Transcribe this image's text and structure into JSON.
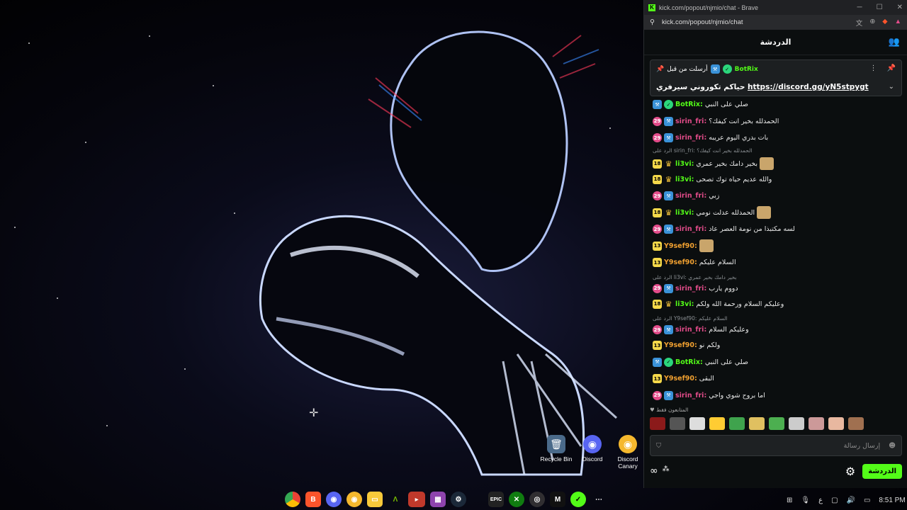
{
  "desktop": {
    "icons": [
      {
        "label": "Recycle Bin",
        "icon": "recycle-bin-icon"
      },
      {
        "label": "Discord",
        "icon": "discord-icon"
      },
      {
        "label": "Discord\nCanary",
        "icon": "discord-canary-icon"
      }
    ]
  },
  "taskbar": {
    "apps": [
      "chrome-icon",
      "brave-icon",
      "discord-icon",
      "discord-canary-icon",
      "file-explorer-icon",
      "nvidia-icon",
      "capcut-icon",
      "winrar-icon",
      "steam-icon",
      "epic-games-icon",
      "xbox-icon",
      "obs-icon",
      "kick-app-icon",
      "green-app-icon",
      "more-icon"
    ],
    "epic_label": "EPIC",
    "tray": {
      "lang": "ع",
      "time": "8:51 PM"
    }
  },
  "browser": {
    "title": "kick.com/popout/njmio/chat - Brave",
    "url": "kick.com/popout/njmio/chat"
  },
  "chat": {
    "header": "الدردشة",
    "pinned": {
      "pinned_by": "أرسلت من قبل",
      "user": "BotRix",
      "text_prefix": "حياكم تكوروني سيرفري",
      "link": "https://discord.gg/yN5stpygt"
    },
    "messages": [
      {
        "badges": [
          "blue",
          "verified"
        ],
        "user": "BotRix:",
        "color": "#53fc18",
        "text": "صلي على النبي"
      },
      {
        "badges": [
          "pink",
          "blue"
        ],
        "badge_text": [
          "29",
          ""
        ],
        "user": "sirin_fri:",
        "color": "#e34c8a",
        "text": "الحمدلله بخير انت كيفك؟"
      },
      {
        "badges": [
          "pink",
          "blue"
        ],
        "badge_text": [
          "29",
          ""
        ],
        "user": "sirin_fri:",
        "color": "#e34c8a",
        "text": "بات بدري اليوم عريبه"
      },
      {
        "reply": "الرد على  sirin_fri: الحمدلله بخير انت كيفك؟",
        "badges": [
          "yel",
          "crown"
        ],
        "badge_text": [
          "18",
          ""
        ],
        "user": "li3vi:",
        "color": "#53fc18",
        "text": "بخير دامك بخير عمري",
        "emote": true
      },
      {
        "badges": [
          "yel",
          "crown"
        ],
        "badge_text": [
          "18",
          ""
        ],
        "user": "li3vi:",
        "color": "#53fc18",
        "text": "والله عديم حياه توك تصحى"
      },
      {
        "badges": [
          "pink",
          "blue"
        ],
        "badge_text": [
          "29",
          ""
        ],
        "user": "sirin_fri:",
        "color": "#e34c8a",
        "text": "زبي"
      },
      {
        "badges": [
          "yel",
          "crown"
        ],
        "badge_text": [
          "18",
          ""
        ],
        "user": "li3vi:",
        "color": "#53fc18",
        "text": "الحمدلله عدلت نومي",
        "emote": true
      },
      {
        "badges": [
          "pink",
          "blue"
        ],
        "badge_text": [
          "29",
          ""
        ],
        "user": "sirin_fri:",
        "color": "#e34c8a",
        "text": "لسه مكتبذا من نومة العصر عاد"
      },
      {
        "badges": [
          "yel"
        ],
        "badge_text": [
          "13"
        ],
        "user": "Y9sef90:",
        "color": "#f0a030",
        "text": "",
        "emote": true
      },
      {
        "badges": [
          "yel"
        ],
        "badge_text": [
          "13"
        ],
        "user": "Y9sef90:",
        "color": "#f0a030",
        "text": "السلام عليكم"
      },
      {
        "reply": "الرد على  li3vi: بخير دامك بخير عمري",
        "badges": [
          "pink",
          "blue"
        ],
        "badge_text": [
          "29",
          ""
        ],
        "user": "sirin_fri:",
        "color": "#e34c8a",
        "text": "دووم يارب"
      },
      {
        "badges": [
          "yel",
          "crown"
        ],
        "badge_text": [
          "18",
          ""
        ],
        "user": "li3vi:",
        "color": "#53fc18",
        "text": "وعليكم السلام ورحمة الله ولكم"
      },
      {
        "reply": "الرد على  Y9sef90: السلام عليكم",
        "badges": [
          "pink",
          "blue"
        ],
        "badge_text": [
          "29",
          ""
        ],
        "user": "sirin_fri:",
        "color": "#e34c8a",
        "text": "وعليكم السلام"
      },
      {
        "badges": [
          "yel"
        ],
        "badge_text": [
          "13"
        ],
        "user": "Y9sef90:",
        "color": "#f0a030",
        "text": "ولكم نو"
      },
      {
        "badges": [
          "blue",
          "verified"
        ],
        "user": "BotRix:",
        "color": "#53fc18",
        "text": "صلي على النبي"
      },
      {
        "badges": [
          "yel"
        ],
        "badge_text": [
          "13"
        ],
        "user": "Y9sef90:",
        "color": "#f0a030",
        "text": "البقى"
      },
      {
        "badges": [
          "pink",
          "blue"
        ],
        "badge_text": [
          "29",
          ""
        ],
        "user": "sirin_fri:",
        "color": "#e34c8a",
        "text": "اما بروح شوي واجي"
      }
    ],
    "emote_bar_label": "المتابعون فقط",
    "input_placeholder": "إرسال رسالة",
    "send_label": "الدردشة"
  }
}
